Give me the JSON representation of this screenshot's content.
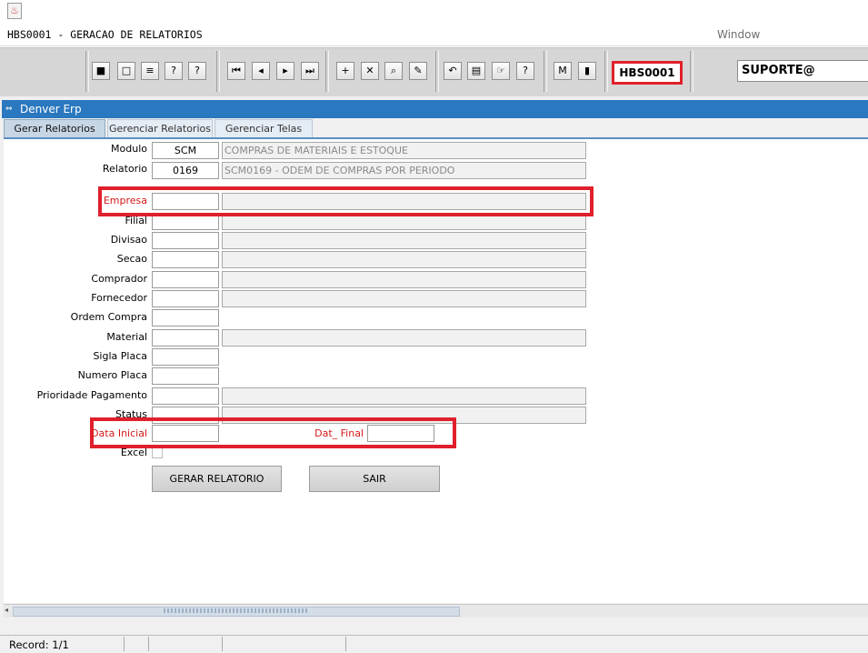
{
  "app": {
    "title": "HBS0001 - GERACAO DE RELATORIOS",
    "window_menu": "Window",
    "icon": "java-cup-icon"
  },
  "toolbar": {
    "form_code": "HBS0001",
    "user": "SUPORTE@",
    "buttons": [
      {
        "name": "save-icon",
        "glyph": "■"
      },
      {
        "name": "window-icon",
        "glyph": "□"
      },
      {
        "name": "print-icon",
        "glyph": "≡"
      },
      {
        "name": "query-help-icon",
        "glyph": "?"
      },
      {
        "name": "execute-query-icon",
        "glyph": "?"
      },
      {
        "name": "first-record-icon",
        "glyph": "⏮"
      },
      {
        "name": "previous-record-icon",
        "glyph": "◂"
      },
      {
        "name": "next-record-icon",
        "glyph": "▸"
      },
      {
        "name": "last-record-icon",
        "glyph": "⏭"
      },
      {
        "name": "insert-record-icon",
        "glyph": "+"
      },
      {
        "name": "delete-record-icon",
        "glyph": "✕"
      },
      {
        "name": "search-record-icon",
        "glyph": "⌕"
      },
      {
        "name": "edit-icon",
        "glyph": "✎"
      },
      {
        "name": "undo-icon",
        "glyph": "↶"
      },
      {
        "name": "clipboard-icon",
        "glyph": "▤"
      },
      {
        "name": "hand-pointer-icon",
        "glyph": "☞"
      },
      {
        "name": "help-icon",
        "glyph": "?"
      },
      {
        "name": "menu-icon",
        "glyph": "M"
      },
      {
        "name": "exit-icon",
        "glyph": "▮"
      }
    ]
  },
  "window": {
    "title": "Denver Erp"
  },
  "tabs": [
    "Gerar Relatorios",
    "Gerenciar Relatorios",
    "Gerenciar Telas"
  ],
  "form": {
    "modulo": {
      "label": "Modulo",
      "code": "SCM",
      "desc": "COMPRAS DE MATERIAIS E ESTOQUE"
    },
    "relatorio": {
      "label": "Relatorio",
      "code": "0169",
      "desc": "SCM0169  - ODEM DE COMPRAS POR PERIODO"
    },
    "empresa": "Empresa",
    "filial": "Filial",
    "divisao": "Divisao",
    "secao": "Secao",
    "comprador": "Comprador",
    "fornecedor": "Fornecedor",
    "ordem_compra": "Ordem Compra",
    "material": "Material",
    "sigla_placa": "Sigla Placa",
    "numero_placa": "Numero Placa",
    "prioridade_pagamento": "Prioridade Pagamento",
    "status": "Status",
    "data_inicial": "Data Inicial",
    "data_final": "Dat_ Final",
    "excel": "Excel"
  },
  "buttons": {
    "gerar": "GERAR RELATORIO",
    "sair": "SAIR"
  },
  "status_bar": {
    "record": "Record: 1/1"
  },
  "colors": {
    "accent": "#2a78bf",
    "highlight": "#e0202c",
    "required_label": "#d41919"
  }
}
